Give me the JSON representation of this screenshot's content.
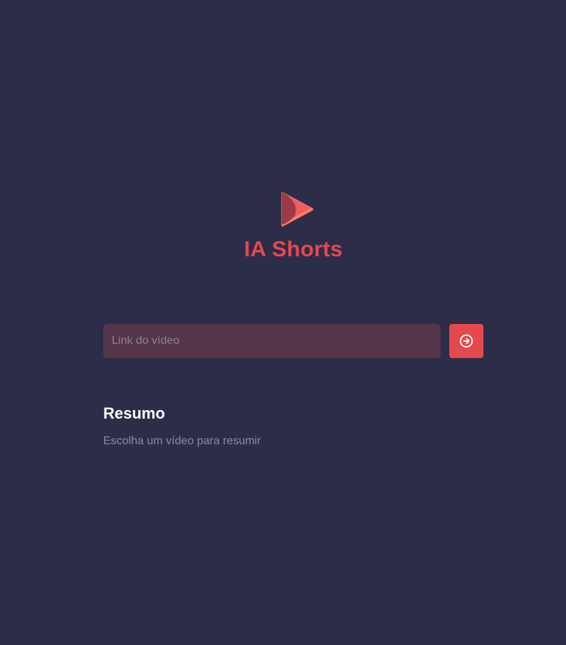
{
  "app": {
    "title": "IA Shorts",
    "logo_icon": "play-triangle-logo-icon"
  },
  "form": {
    "url_input": {
      "placeholder": "Link do vídeo",
      "value": ""
    },
    "submit_icon": "arrow-circle-right-icon"
  },
  "summary": {
    "title": "Resumo",
    "text": "Escolha um vídeo para resumir"
  },
  "colors": {
    "background": "#2c2d48",
    "accent": "#e5484d",
    "input_background": "#55354a",
    "muted_text": "#8b8ba3",
    "heading_text": "#ffffff"
  }
}
